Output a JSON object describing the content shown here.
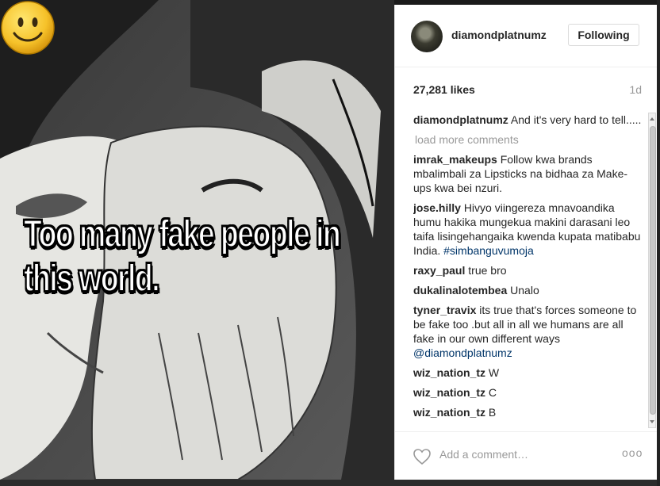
{
  "post": {
    "caption_line1": "Too many fake people in",
    "caption_line2": "this world.",
    "smiley_icon": "smiley-face-emoji"
  },
  "header": {
    "username": "diamondplatnumz",
    "follow_label": "Following"
  },
  "stats": {
    "likes": "27,281 likes",
    "time": "1d"
  },
  "comments": {
    "load_more": "load more comments",
    "items": [
      {
        "user": "diamondplatnumz",
        "text": "And it's very hard to tell....."
      },
      {
        "user": "imrak_makeups",
        "text": "Follow kwa brands mbalimbali za Lipsticks na bidhaa za Make-ups kwa bei nzuri."
      },
      {
        "user": "jose.hilly",
        "text": "Hivyo viingereza mnavoandika humu hakika mungekua makini darasani leo taifa lisingehangaika kwenda kupata matibabu India.",
        "tag": "#simbanguvumoja"
      },
      {
        "user": "raxy_paul",
        "text": "true bro"
      },
      {
        "user": "dukalinalotembea",
        "text": "Unalo"
      },
      {
        "user": "tyner_travix",
        "text": "its true that's forces someone to be fake too .but all in all we humans are all fake in our own different ways",
        "mention": "@diamondplatnumz"
      },
      {
        "user": "wiz_nation_tz",
        "text": "W"
      },
      {
        "user": "wiz_nation_tz",
        "text": "C"
      },
      {
        "user": "wiz_nation_tz",
        "text": "B"
      }
    ]
  },
  "footer": {
    "add_comment_placeholder": "Add a comment…",
    "more_label": "ooo",
    "heart_icon": "heart-outline-icon"
  },
  "colors": {
    "link": "#003569",
    "muted": "#999999",
    "text": "#262626"
  }
}
